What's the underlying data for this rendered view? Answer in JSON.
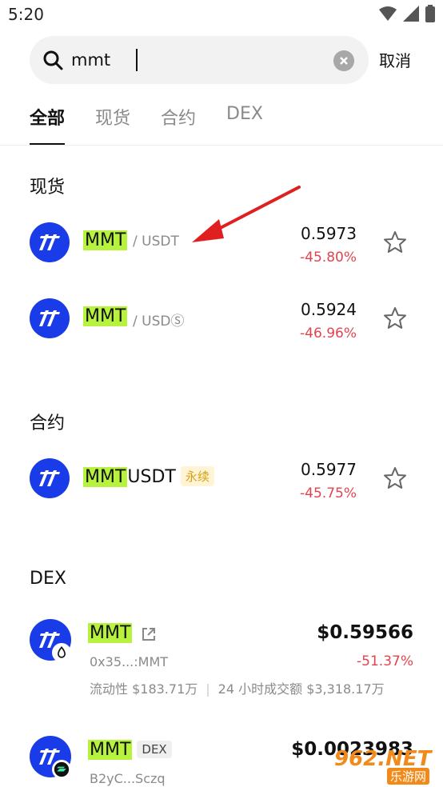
{
  "status": {
    "time": "5:20"
  },
  "search": {
    "value": "mmt",
    "cancel_label": "取消"
  },
  "tabs": [
    {
      "label": "全部",
      "active": true
    },
    {
      "label": "现货",
      "active": false
    },
    {
      "label": "合约",
      "active": false
    },
    {
      "label": "DEX",
      "active": false
    }
  ],
  "spot": {
    "title": "现货",
    "items": [
      {
        "symbol": "MMT",
        "pair": " / USDT",
        "price": "0.5973",
        "change": "-45.80%"
      },
      {
        "symbol": "MMT",
        "pair": " / USDⓈ",
        "price": "0.5924",
        "change": "-46.96%"
      }
    ]
  },
  "futures": {
    "title": "合约",
    "items": [
      {
        "symbol": "MMT",
        "suffix": "USDT",
        "badge": "永续",
        "price": "0.5977",
        "change": "-45.75%"
      }
    ]
  },
  "dex": {
    "title": "DEX",
    "items": [
      {
        "symbol": "MMT",
        "address": "0x35...:MMT",
        "liquidity": "流动性 $183.71万",
        "volume": "24 小时成交额 $3,318.17万",
        "price": "$0.59566",
        "change": "-51.37%"
      },
      {
        "symbol": "MMT",
        "badge": "DEX",
        "address": "B2yC...Sczq",
        "price": "$0.0023983",
        "change": ""
      }
    ]
  },
  "watermark": {
    "text": "962.NET",
    "subtext": "乐游网"
  },
  "colors": {
    "accent": "#1a3ce8",
    "highlight": "#b7f33e",
    "negative": "#e2444f",
    "annotation_arrow": "#e02020"
  }
}
